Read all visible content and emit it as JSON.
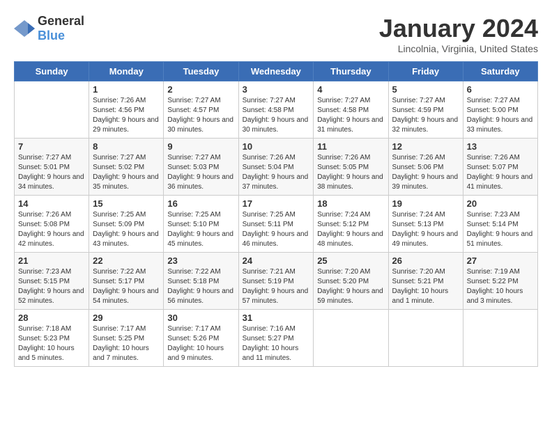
{
  "logo": {
    "general": "General",
    "blue": "Blue"
  },
  "header": {
    "title": "January 2024",
    "location": "Lincolnia, Virginia, United States"
  },
  "weekdays": [
    "Sunday",
    "Monday",
    "Tuesday",
    "Wednesday",
    "Thursday",
    "Friday",
    "Saturday"
  ],
  "weeks": [
    [
      {
        "day": "",
        "sunrise": "",
        "sunset": "",
        "daylight": ""
      },
      {
        "day": "1",
        "sunrise": "Sunrise: 7:26 AM",
        "sunset": "Sunset: 4:56 PM",
        "daylight": "Daylight: 9 hours and 29 minutes."
      },
      {
        "day": "2",
        "sunrise": "Sunrise: 7:27 AM",
        "sunset": "Sunset: 4:57 PM",
        "daylight": "Daylight: 9 hours and 30 minutes."
      },
      {
        "day": "3",
        "sunrise": "Sunrise: 7:27 AM",
        "sunset": "Sunset: 4:58 PM",
        "daylight": "Daylight: 9 hours and 30 minutes."
      },
      {
        "day": "4",
        "sunrise": "Sunrise: 7:27 AM",
        "sunset": "Sunset: 4:58 PM",
        "daylight": "Daylight: 9 hours and 31 minutes."
      },
      {
        "day": "5",
        "sunrise": "Sunrise: 7:27 AM",
        "sunset": "Sunset: 4:59 PM",
        "daylight": "Daylight: 9 hours and 32 minutes."
      },
      {
        "day": "6",
        "sunrise": "Sunrise: 7:27 AM",
        "sunset": "Sunset: 5:00 PM",
        "daylight": "Daylight: 9 hours and 33 minutes."
      }
    ],
    [
      {
        "day": "7",
        "sunrise": "Sunrise: 7:27 AM",
        "sunset": "Sunset: 5:01 PM",
        "daylight": "Daylight: 9 hours and 34 minutes."
      },
      {
        "day": "8",
        "sunrise": "Sunrise: 7:27 AM",
        "sunset": "Sunset: 5:02 PM",
        "daylight": "Daylight: 9 hours and 35 minutes."
      },
      {
        "day": "9",
        "sunrise": "Sunrise: 7:27 AM",
        "sunset": "Sunset: 5:03 PM",
        "daylight": "Daylight: 9 hours and 36 minutes."
      },
      {
        "day": "10",
        "sunrise": "Sunrise: 7:26 AM",
        "sunset": "Sunset: 5:04 PM",
        "daylight": "Daylight: 9 hours and 37 minutes."
      },
      {
        "day": "11",
        "sunrise": "Sunrise: 7:26 AM",
        "sunset": "Sunset: 5:05 PM",
        "daylight": "Daylight: 9 hours and 38 minutes."
      },
      {
        "day": "12",
        "sunrise": "Sunrise: 7:26 AM",
        "sunset": "Sunset: 5:06 PM",
        "daylight": "Daylight: 9 hours and 39 minutes."
      },
      {
        "day": "13",
        "sunrise": "Sunrise: 7:26 AM",
        "sunset": "Sunset: 5:07 PM",
        "daylight": "Daylight: 9 hours and 41 minutes."
      }
    ],
    [
      {
        "day": "14",
        "sunrise": "Sunrise: 7:26 AM",
        "sunset": "Sunset: 5:08 PM",
        "daylight": "Daylight: 9 hours and 42 minutes."
      },
      {
        "day": "15",
        "sunrise": "Sunrise: 7:25 AM",
        "sunset": "Sunset: 5:09 PM",
        "daylight": "Daylight: 9 hours and 43 minutes."
      },
      {
        "day": "16",
        "sunrise": "Sunrise: 7:25 AM",
        "sunset": "Sunset: 5:10 PM",
        "daylight": "Daylight: 9 hours and 45 minutes."
      },
      {
        "day": "17",
        "sunrise": "Sunrise: 7:25 AM",
        "sunset": "Sunset: 5:11 PM",
        "daylight": "Daylight: 9 hours and 46 minutes."
      },
      {
        "day": "18",
        "sunrise": "Sunrise: 7:24 AM",
        "sunset": "Sunset: 5:12 PM",
        "daylight": "Daylight: 9 hours and 48 minutes."
      },
      {
        "day": "19",
        "sunrise": "Sunrise: 7:24 AM",
        "sunset": "Sunset: 5:13 PM",
        "daylight": "Daylight: 9 hours and 49 minutes."
      },
      {
        "day": "20",
        "sunrise": "Sunrise: 7:23 AM",
        "sunset": "Sunset: 5:14 PM",
        "daylight": "Daylight: 9 hours and 51 minutes."
      }
    ],
    [
      {
        "day": "21",
        "sunrise": "Sunrise: 7:23 AM",
        "sunset": "Sunset: 5:15 PM",
        "daylight": "Daylight: 9 hours and 52 minutes."
      },
      {
        "day": "22",
        "sunrise": "Sunrise: 7:22 AM",
        "sunset": "Sunset: 5:17 PM",
        "daylight": "Daylight: 9 hours and 54 minutes."
      },
      {
        "day": "23",
        "sunrise": "Sunrise: 7:22 AM",
        "sunset": "Sunset: 5:18 PM",
        "daylight": "Daylight: 9 hours and 56 minutes."
      },
      {
        "day": "24",
        "sunrise": "Sunrise: 7:21 AM",
        "sunset": "Sunset: 5:19 PM",
        "daylight": "Daylight: 9 hours and 57 minutes."
      },
      {
        "day": "25",
        "sunrise": "Sunrise: 7:20 AM",
        "sunset": "Sunset: 5:20 PM",
        "daylight": "Daylight: 9 hours and 59 minutes."
      },
      {
        "day": "26",
        "sunrise": "Sunrise: 7:20 AM",
        "sunset": "Sunset: 5:21 PM",
        "daylight": "Daylight: 10 hours and 1 minute."
      },
      {
        "day": "27",
        "sunrise": "Sunrise: 7:19 AM",
        "sunset": "Sunset: 5:22 PM",
        "daylight": "Daylight: 10 hours and 3 minutes."
      }
    ],
    [
      {
        "day": "28",
        "sunrise": "Sunrise: 7:18 AM",
        "sunset": "Sunset: 5:23 PM",
        "daylight": "Daylight: 10 hours and 5 minutes."
      },
      {
        "day": "29",
        "sunrise": "Sunrise: 7:17 AM",
        "sunset": "Sunset: 5:25 PM",
        "daylight": "Daylight: 10 hours and 7 minutes."
      },
      {
        "day": "30",
        "sunrise": "Sunrise: 7:17 AM",
        "sunset": "Sunset: 5:26 PM",
        "daylight": "Daylight: 10 hours and 9 minutes."
      },
      {
        "day": "31",
        "sunrise": "Sunrise: 7:16 AM",
        "sunset": "Sunset: 5:27 PM",
        "daylight": "Daylight: 10 hours and 11 minutes."
      },
      {
        "day": "",
        "sunrise": "",
        "sunset": "",
        "daylight": ""
      },
      {
        "day": "",
        "sunrise": "",
        "sunset": "",
        "daylight": ""
      },
      {
        "day": "",
        "sunrise": "",
        "sunset": "",
        "daylight": ""
      }
    ]
  ]
}
